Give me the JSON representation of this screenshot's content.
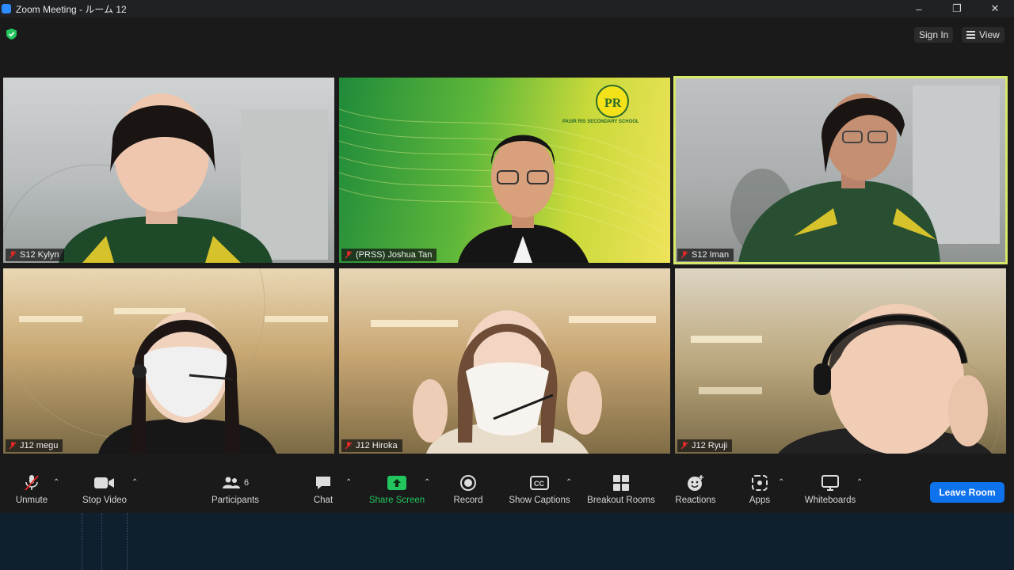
{
  "window": {
    "title": "Zoom Meeting - ルーム 12",
    "minimize": "–",
    "restore": "❐",
    "close": "✕"
  },
  "topbar": {
    "sign_in": "Sign In",
    "view": "View",
    "shield_icon": "shield-check-icon"
  },
  "tiles": [
    {
      "name": "S12 Kylyn",
      "muted": true,
      "active": false
    },
    {
      "name": "(PRSS) Joshua Tan",
      "muted": true,
      "active": false,
      "school_text": "PASIR RIS SECONDARY SCHOOL"
    },
    {
      "name": "S12 Iman",
      "muted": true,
      "active": true
    },
    {
      "name": "J12 megu",
      "muted": true,
      "active": false
    },
    {
      "name": "J12 Hiroka",
      "muted": true,
      "active": false
    },
    {
      "name": "J12 Ryuji",
      "muted": true,
      "active": false
    }
  ],
  "toolbar": {
    "unmute": "Unmute",
    "stop_video": "Stop Video",
    "participants": "Participants",
    "participants_count": "6",
    "chat": "Chat",
    "share_screen": "Share Screen",
    "record": "Record",
    "show_captions": "Show Captions",
    "breakout_rooms": "Breakout Rooms",
    "reactions": "Reactions",
    "apps": "Apps",
    "whiteboards": "Whiteboards",
    "leave_room": "Leave Room"
  },
  "colors": {
    "accent_blue": "#0e72ed",
    "share_green": "#22c55e",
    "active_speaker": "#d7e86a",
    "muted_red": "#e02828"
  }
}
